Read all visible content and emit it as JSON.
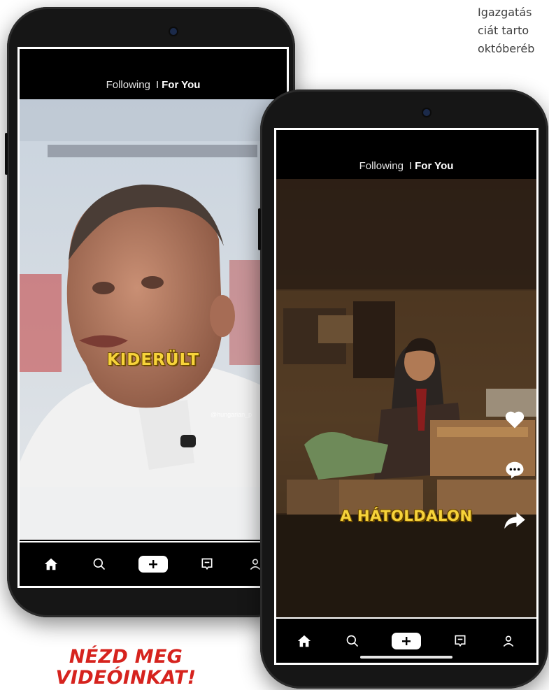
{
  "article": {
    "lines": [
      "Igazgatás",
      "ciát tarto",
      "októberéb"
    ]
  },
  "phone_left": {
    "tabs": {
      "following": "Following",
      "separator": "I",
      "for_you": "For You"
    },
    "caption": "KIDERÜLT",
    "credit": "@hungarian_p",
    "nav": [
      "home-icon",
      "search-icon",
      "create-icon",
      "inbox-icon",
      "profile-icon"
    ]
  },
  "phone_right": {
    "tabs": {
      "following": "Following",
      "separator": "I",
      "for_you": "For You"
    },
    "caption": "A HÁTOLDALON",
    "actions": [
      "heart-icon",
      "comment-icon",
      "share-icon"
    ],
    "nav": [
      "home-icon",
      "search-icon",
      "create-icon",
      "inbox-icon",
      "profile-icon"
    ]
  },
  "promo": {
    "line1": "NÉZD MEG",
    "line2": "VIDEÓINKAT!"
  },
  "colors": {
    "caption": "#f7d33a",
    "promo": "#d6231e",
    "frame": "#161616"
  }
}
